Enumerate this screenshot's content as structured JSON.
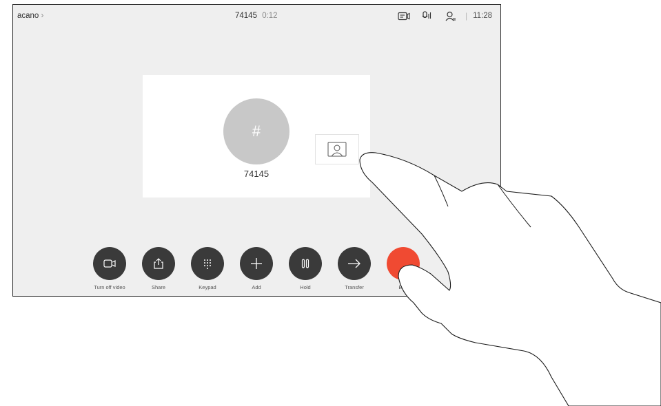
{
  "topbar": {
    "device_name": "acano",
    "call_number": "74145",
    "call_duration": "0:12",
    "icons": [
      "camera-icon",
      "microphone-icon",
      "person-icon"
    ],
    "clock": "11:28"
  },
  "call_card": {
    "avatar_symbol": "#",
    "name": "74145",
    "selfview_icon": "person-icon"
  },
  "controls": [
    {
      "label": "Turn off video",
      "icon": "video-camera-icon"
    },
    {
      "label": "Share",
      "icon": "share-icon"
    },
    {
      "label": "Keypad",
      "icon": "keypad-icon"
    },
    {
      "label": "Add",
      "icon": "plus-icon"
    },
    {
      "label": "Hold",
      "icon": "pause-icon"
    },
    {
      "label": "Transfer",
      "icon": "arrow-right-icon"
    },
    {
      "label": "End",
      "icon": "end-call-icon"
    }
  ],
  "colors": {
    "screen_bg": "#efefef",
    "button_dark": "#3a3a3a",
    "end_red": "#f04a32",
    "avatar_gray": "#c8c8c8"
  }
}
